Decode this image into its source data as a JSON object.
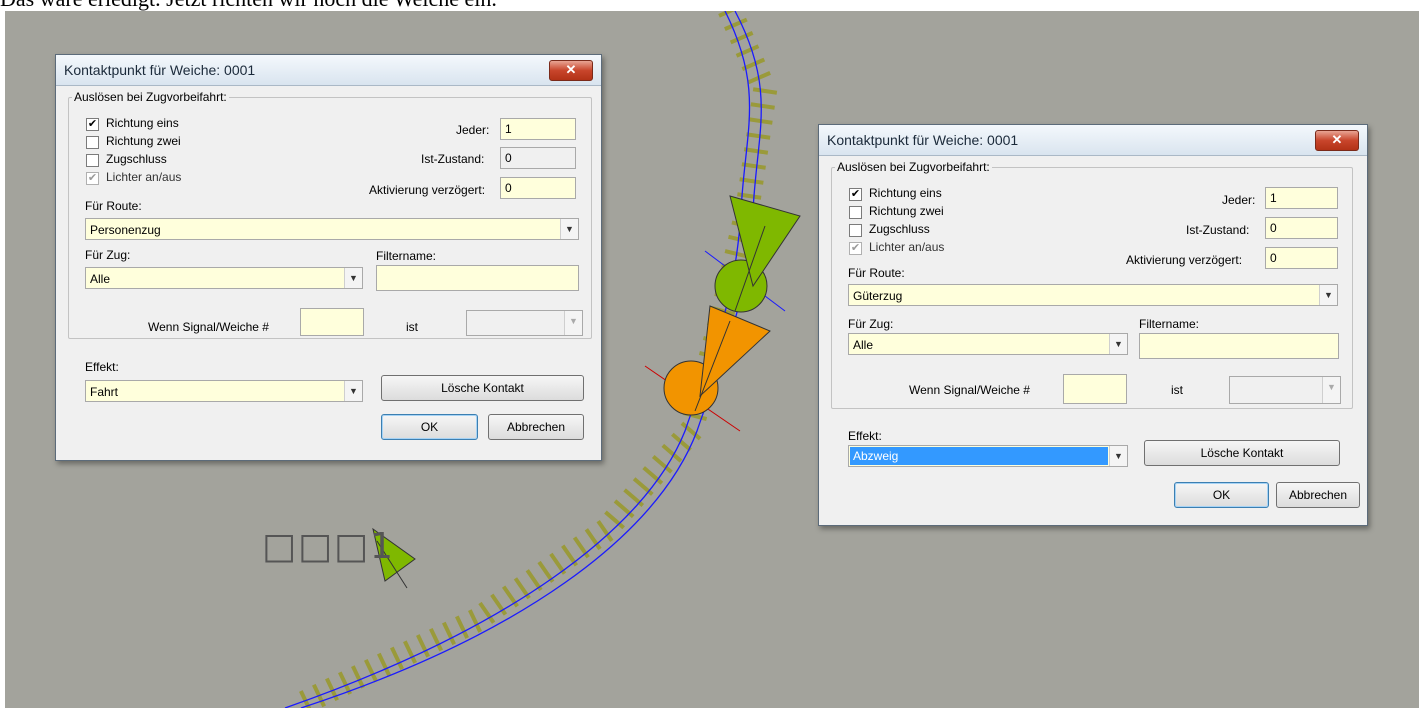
{
  "caption": "Das wäre erledigt. Jetzt richten wir noch die Weiche ein.",
  "canvas": {
    "node_label": "□□□1"
  },
  "dialogs": [
    {
      "title": "Kontaktpunkt für Weiche: 0001",
      "close": "✕",
      "group_legend": "Auslösen bei Zugvorbeifahrt:",
      "checkboxes": [
        {
          "label": "Richtung eins",
          "mark": "✔"
        },
        {
          "label": "Richtung zwei",
          "mark": ""
        },
        {
          "label": "Zugschluss",
          "mark": ""
        },
        {
          "label": "Lichter an/aus",
          "mark": "✔"
        }
      ],
      "jeder_label": "Jeder:",
      "jeder_value": "1",
      "ist_zustand_label": "Ist-Zustand:",
      "ist_zustand_value": "0",
      "aktivierung_label": "Aktivierung verzögert:",
      "aktivierung_value": "0",
      "route_label": "Für Route:",
      "route_value": "Personenzug",
      "zug_label": "Für Zug:",
      "zug_value": "Alle",
      "filtername_label": "Filtername:",
      "filtername_value": "",
      "signal_label": "Wenn Signal/Weiche #",
      "signal_value": "",
      "ist_label": "ist",
      "ist_value": "",
      "effekt_label": "Effekt:",
      "effekt_value": "Fahrt",
      "loesche_label": "Lösche Kontakt",
      "ok_label": "OK",
      "abbrechen_label": "Abbrechen",
      "arrow": "▼"
    },
    {
      "title": "Kontaktpunkt für Weiche: 0001",
      "close": "✕",
      "group_legend": "Auslösen bei Zugvorbeifahrt:",
      "checkboxes": [
        {
          "label": "Richtung eins",
          "mark": "✔"
        },
        {
          "label": "Richtung zwei",
          "mark": ""
        },
        {
          "label": "Zugschluss",
          "mark": ""
        },
        {
          "label": "Lichter an/aus",
          "mark": "✔"
        }
      ],
      "jeder_label": "Jeder:",
      "jeder_value": "1",
      "ist_zustand_label": "Ist-Zustand:",
      "ist_zustand_value": "0",
      "aktivierung_label": "Aktivierung verzögert:",
      "aktivierung_value": "0",
      "route_label": "Für Route:",
      "route_value": "Güterzug",
      "zug_label": "Für Zug:",
      "zug_value": "Alle",
      "filtername_label": "Filtername:",
      "filtername_value": "",
      "signal_label": "Wenn Signal/Weiche #",
      "signal_value": "",
      "ist_label": "ist",
      "ist_value": "",
      "effekt_label": "Effekt:",
      "effekt_value": "Abzweig",
      "loesche_label": "Lösche Kontakt",
      "ok_label": "OK",
      "abbrechen_label": "Abbrechen",
      "arrow": "▼"
    }
  ],
  "colors": {
    "canvas": "#a3a39c",
    "track_rail": "#1a1aff",
    "sleeper": "#9a9a3a",
    "marker_green": "#7fb800",
    "marker_orange": "#f29400",
    "field_bg": "#ffffdc",
    "selection": "#3399ff"
  }
}
